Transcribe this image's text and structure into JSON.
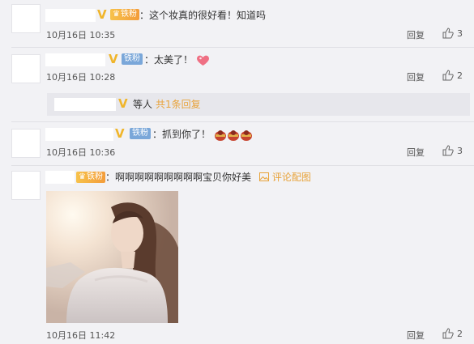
{
  "comments": [
    {
      "fan_label": "铁粉",
      "text": "：这个妆真的很好看！知道吗",
      "time": "10月16日 10:35",
      "reply_label": "回复",
      "likes": "3"
    },
    {
      "fan_label": "铁粉",
      "text": "：太美了！",
      "time": "10月16日 10:28",
      "reply_label": "回复",
      "likes": "2",
      "sub": {
        "text": "等人",
        "link": "共1条回复"
      }
    },
    {
      "fan_label": "铁粉",
      "text": "：抓到你了！",
      "time": "10月16日 10:36",
      "reply_label": "回复",
      "likes": "3"
    },
    {
      "fan_label": "铁粉",
      "text": "：啊啊啊啊啊啊啊啊啊宝贝你好美",
      "pic_link": "评论配图",
      "time": "10月16日 11:42",
      "reply_label": "回复",
      "likes": "2"
    }
  ],
  "colors": {
    "link": "#e8a33a",
    "badge_gold": "#f0b52a",
    "fan_blue": "#7aa7d9"
  },
  "icons": [
    "thumbs-up-icon",
    "image-icon",
    "heart-icon",
    "red-envelope-icon"
  ]
}
